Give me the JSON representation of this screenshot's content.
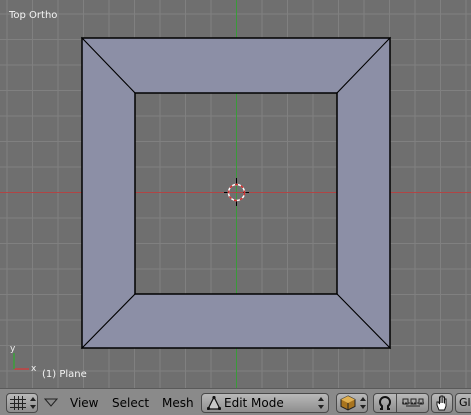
{
  "viewport": {
    "view_label": "Top Ortho",
    "object_label": "(1) Plane",
    "axis_x_label": "x",
    "axis_y_label": "y",
    "grid_color": "#808080",
    "x_axis_color": "#b04545",
    "y_axis_color": "#3a9a3a",
    "face_color": "#8c8fa6",
    "edge_color": "#000000"
  },
  "header": {
    "editor_type_icon": "grid-icon",
    "menus": {
      "view": "View",
      "select": "Select",
      "mesh": "Mesh"
    },
    "mode": {
      "label": "Edit Mode",
      "icon": "edit-mode-triangle-icon"
    },
    "shading_icon": "solid-draw-mode-icon",
    "pivot_icon": "pivot-point-icon",
    "manipulator_icon": "manipulator-icon",
    "hand_icon": "hand-icon",
    "gl_label": "Gl"
  }
}
